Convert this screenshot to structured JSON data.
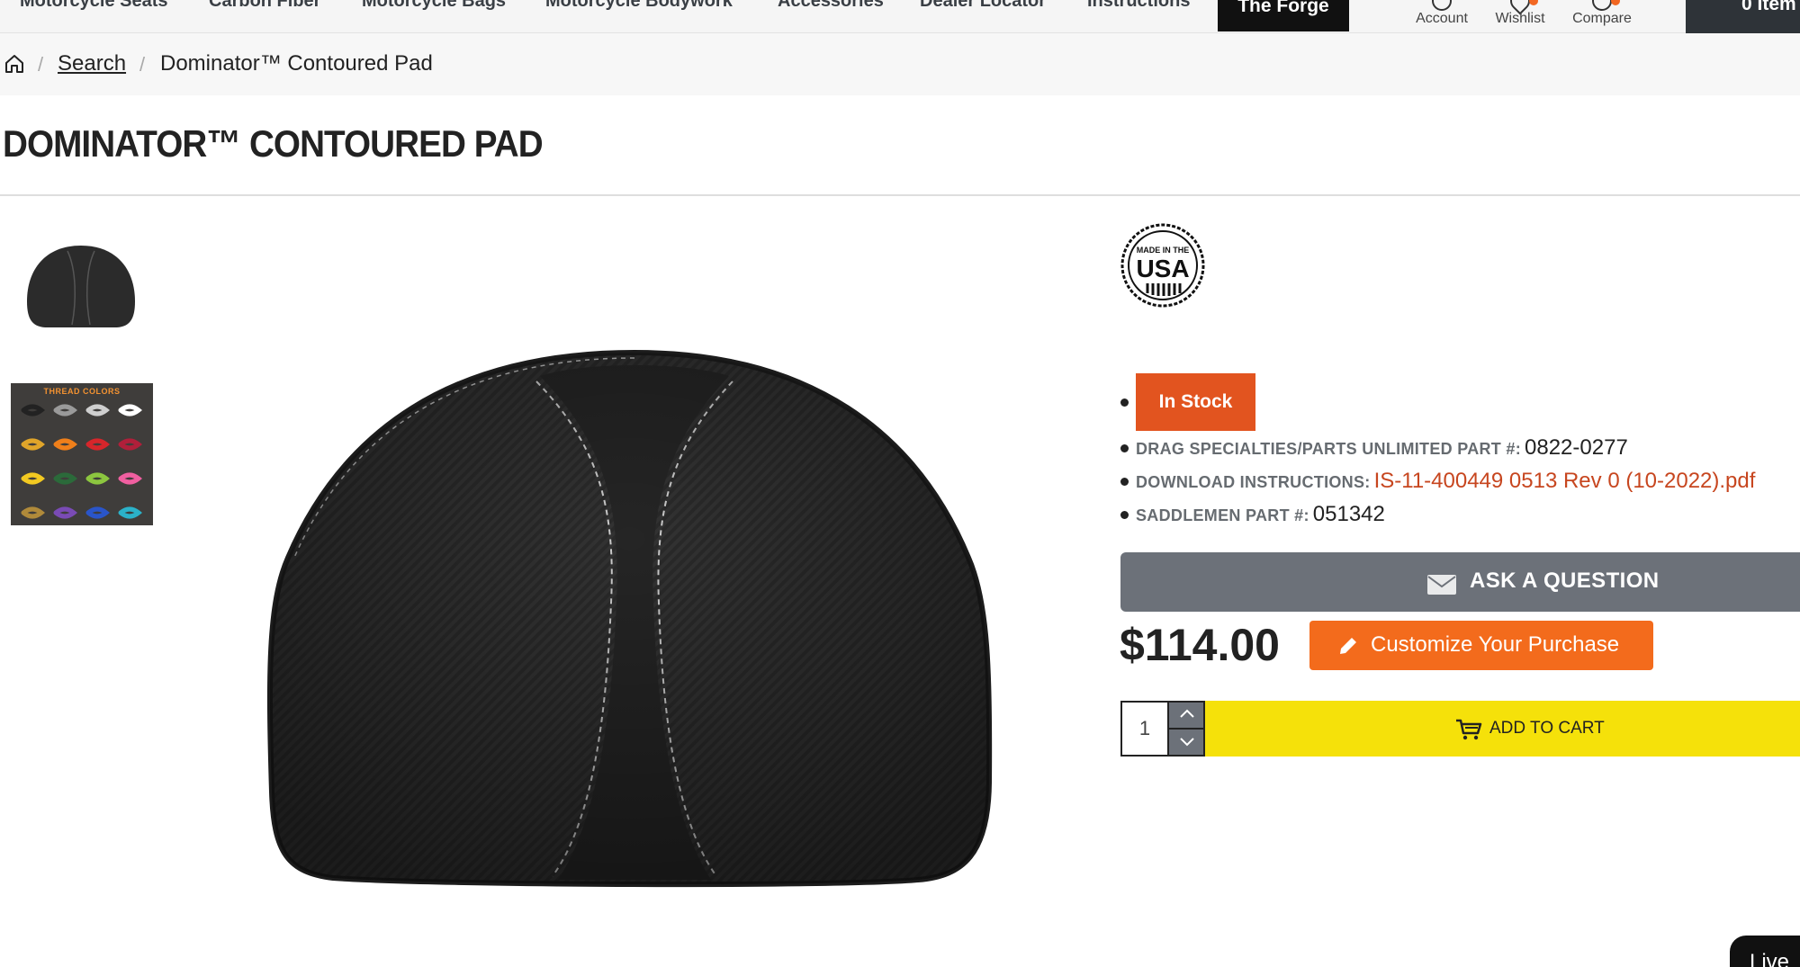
{
  "nav": {
    "items": [
      {
        "label": "Motorcycle Seats"
      },
      {
        "label": "Carbon Fiber"
      },
      {
        "label": "Motorcycle Bags"
      },
      {
        "label": "Motorcycle Bodywork"
      },
      {
        "label": "Accessories"
      },
      {
        "label": "Dealer Locator"
      },
      {
        "label": "Instructions"
      }
    ],
    "forge_label": "The Forge",
    "account_label": "Account",
    "wishlist_label": "Wishlist",
    "compare_label": "Compare",
    "cart_label": "0 Item"
  },
  "breadcrumb": {
    "home_icon": "home-icon",
    "search_label": "Search",
    "current": "Dominator™ Contoured Pad"
  },
  "product": {
    "title": "DOMINATOR™ CONTOURED PAD",
    "thread_colors_title": "THREAD COLORS",
    "badge_text": "MADE IN THE USA",
    "stock_label": "In Stock",
    "specs": [
      {
        "key": "DRAG SPECIALTIES/PARTS UNLIMITED PART #:",
        "value": "0822-0277"
      },
      {
        "key": "DOWNLOAD INSTRUCTIONS:",
        "value": "IS-11-400449 0513 Rev 0 (10-2022).pdf"
      },
      {
        "key": "SADDLEMEN PART #:",
        "value": "051342"
      }
    ],
    "ask_label": "ASK A QUESTION",
    "price": "$114.00",
    "customize_label": "Customize Your Purchase",
    "quantity": "1",
    "add_to_cart_label": "ADD TO CART"
  },
  "live_chat_label": "Live",
  "colors": {
    "stock_badge": "#e2541f",
    "customize_button": "#f36b1c",
    "add_to_cart": "#f5e10a",
    "link": "#c7461f"
  }
}
